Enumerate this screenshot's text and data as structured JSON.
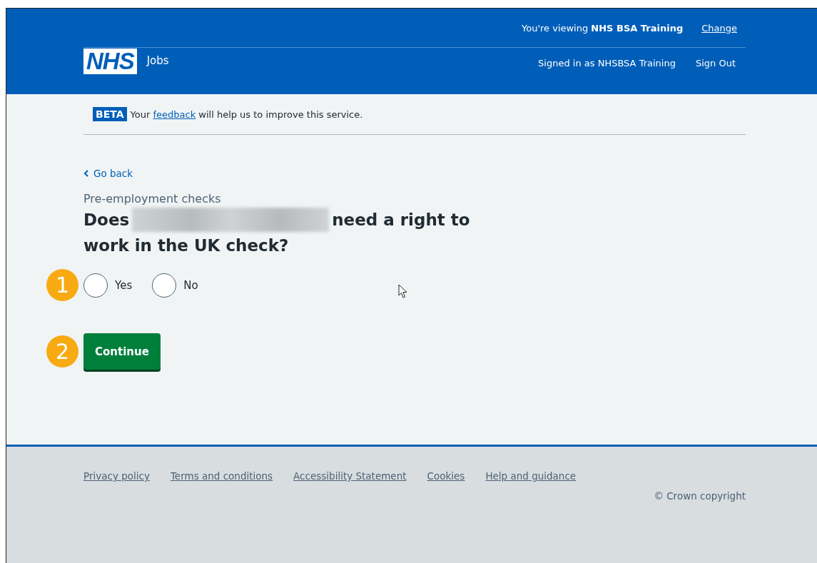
{
  "header": {
    "logo": "NHS",
    "service": "Jobs",
    "viewing_prefix": "You're viewing ",
    "viewing_org": "NHS BSA Training",
    "change_link": "Change",
    "signed_in": "Signed in as NHSBSA Training",
    "sign_out": "Sign Out"
  },
  "beta_banner": {
    "tag": "BETA",
    "before": "Your ",
    "link": "feedback",
    "after": " will help us to improve this service."
  },
  "back_link": "Go back",
  "caption": "Pre-employment checks",
  "question": {
    "before": "Does",
    "redacted": true,
    "after": "need a right to",
    "second_line": "work in the UK check?"
  },
  "options": [
    {
      "label": "Yes",
      "selected": false
    },
    {
      "label": "No",
      "selected": false
    }
  ],
  "continue_button": "Continue",
  "callouts": [
    "1",
    "2"
  ],
  "footer": {
    "links": [
      "Privacy policy",
      "Terms and conditions",
      "Accessibility Statement",
      "Cookies",
      "Help and guidance"
    ],
    "copyright": "© Crown copyright"
  }
}
